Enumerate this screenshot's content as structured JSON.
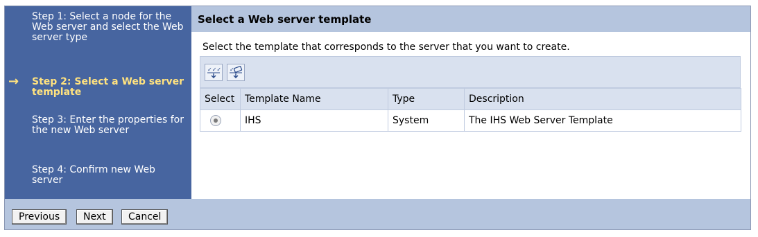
{
  "wizard": {
    "steps": [
      {
        "label": "Step 1: Select a node for the Web server and select the Web server type"
      },
      {
        "label": "Step 2: Select a Web server template",
        "current": true
      },
      {
        "label": "Step 3: Enter the properties for the new Web server"
      },
      {
        "label": "Step 4: Confirm new Web server"
      }
    ],
    "current_indicator": "→"
  },
  "panel": {
    "title": "Select a Web server template",
    "instruction": "Select the template that corresponds to the server that you want to create."
  },
  "toolbar": {
    "icons": [
      "select-all-icon",
      "deselect-all-icon"
    ]
  },
  "table": {
    "headers": [
      "Select",
      "Template Name",
      "Type",
      "Description"
    ],
    "rows": [
      {
        "selected": true,
        "name": "IHS",
        "type": "System",
        "description": "The IHS Web Server Template"
      }
    ]
  },
  "buttons": {
    "previous": "Previous",
    "next": "Next",
    "cancel": "Cancel"
  }
}
